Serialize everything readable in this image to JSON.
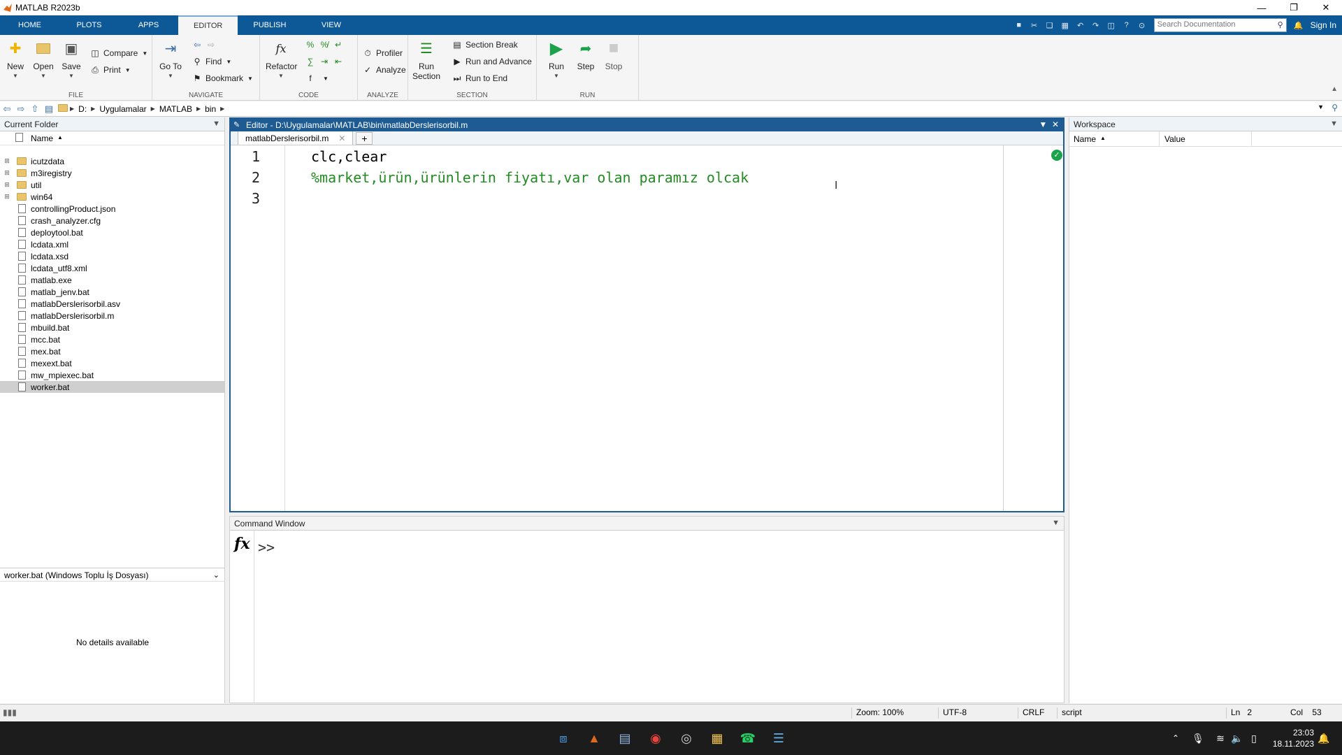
{
  "window": {
    "title": "MATLAB R2023b"
  },
  "tabs": [
    "HOME",
    "PLOTS",
    "APPS",
    "EDITOR",
    "PUBLISH",
    "VIEW"
  ],
  "search": {
    "placeholder": "Search Documentation"
  },
  "signin": "Sign In",
  "ribbon": {
    "file": {
      "label": "FILE",
      "new": "New",
      "open": "Open",
      "save": "Save",
      "compare": "Compare",
      "print": "Print"
    },
    "navigate": {
      "label": "NAVIGATE",
      "goto": "Go To",
      "find": "Find",
      "bookmark": "Bookmark"
    },
    "code": {
      "label": "CODE",
      "refactor": "Refactor"
    },
    "analyze": {
      "label": "ANALYZE",
      "profiler": "Profiler",
      "analyze": "Analyze"
    },
    "section": {
      "label": "SECTION",
      "run_section_1": "Run",
      "run_section_2": "Section",
      "section_break": "Section Break",
      "run_advance": "Run and Advance",
      "run_end": "Run to End"
    },
    "run": {
      "label": "RUN",
      "run": "Run",
      "step": "Step",
      "stop": "Stop"
    }
  },
  "address": [
    "D:",
    "Uygulamalar",
    "MATLAB",
    "bin"
  ],
  "current_folder": {
    "title": "Current Folder",
    "col_name": "Name",
    "items": [
      {
        "name": "icutzdata",
        "type": "folder"
      },
      {
        "name": "m3iregistry",
        "type": "folder"
      },
      {
        "name": "util",
        "type": "folder"
      },
      {
        "name": "win64",
        "type": "folder"
      },
      {
        "name": "controllingProduct.json",
        "type": "file"
      },
      {
        "name": "crash_analyzer.cfg",
        "type": "file"
      },
      {
        "name": "deploytool.bat",
        "type": "file"
      },
      {
        "name": "lcdata.xml",
        "type": "file"
      },
      {
        "name": "lcdata.xsd",
        "type": "file"
      },
      {
        "name": "lcdata_utf8.xml",
        "type": "file"
      },
      {
        "name": "matlab.exe",
        "type": "file"
      },
      {
        "name": "matlab_jenv.bat",
        "type": "file"
      },
      {
        "name": "matlabDerslerisorbil.asv",
        "type": "file"
      },
      {
        "name": "matlabDerslerisorbil.m",
        "type": "file"
      },
      {
        "name": "mbuild.bat",
        "type": "file"
      },
      {
        "name": "mcc.bat",
        "type": "file"
      },
      {
        "name": "mex.bat",
        "type": "file"
      },
      {
        "name": "mexext.bat",
        "type": "file"
      },
      {
        "name": "mw_mpiexec.bat",
        "type": "file"
      },
      {
        "name": "worker.bat",
        "type": "file"
      }
    ],
    "selected": "worker.bat",
    "details_header": "worker.bat  (Windows Toplu İş Dosyası)",
    "details_empty": "No details available"
  },
  "editor": {
    "title": "Editor - D:\\Uygulamalar\\MATLAB\\bin\\matlabDerslerisorbil.m",
    "tab": "matlabDerslerisorbil.m",
    "lines": [
      "1",
      "2",
      "3"
    ],
    "code_line1": "clc,clear",
    "code_line2": "%market,ürün,ürünlerin fiyatı,var olan paramız olcak"
  },
  "command_window": {
    "title": "Command Window",
    "prompt": ">>"
  },
  "workspace": {
    "title": "Workspace",
    "col_name": "Name",
    "col_value": "Value"
  },
  "status": {
    "zoom": "Zoom: 100%",
    "encoding": "UTF-8",
    "eol": "CRLF",
    "type": "script",
    "ln_label": "Ln",
    "ln": "2",
    "col_label": "Col",
    "col": "53"
  },
  "clock": {
    "time": "23:03",
    "date": "18.11.2023"
  }
}
